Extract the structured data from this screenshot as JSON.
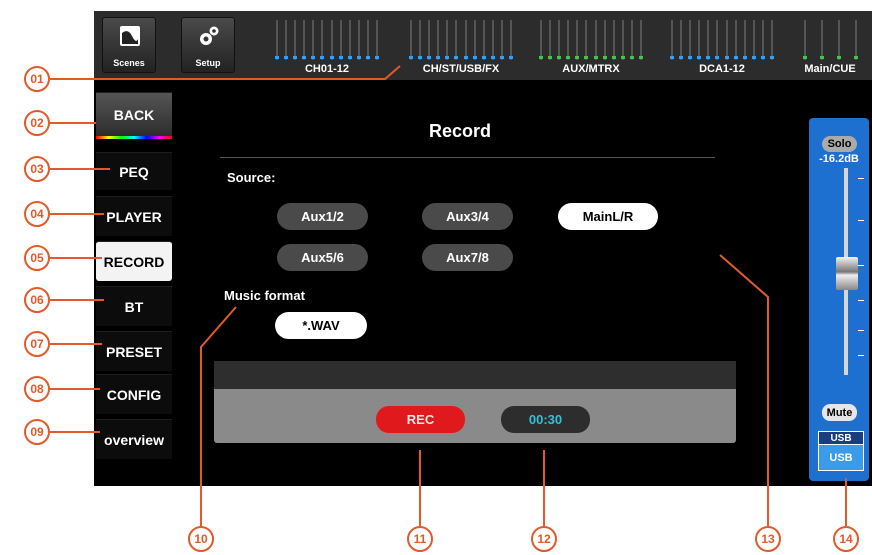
{
  "topbar": {
    "scenes_label": "Scenes",
    "setup_label": "Setup",
    "groups": [
      {
        "label": "CH01-12",
        "dot_color": "#2fa0ff"
      },
      {
        "label": "CH/ST/USB/FX",
        "dot_color": "#2fa0ff"
      },
      {
        "label": "AUX/MTRX",
        "dot_color": "#3ec84a"
      },
      {
        "label": "DCA1-12",
        "dot_color": "#2fa0ff"
      },
      {
        "label": "Main/CUE",
        "dot_color": "#3ec84a"
      }
    ]
  },
  "menu": {
    "back": "BACK",
    "items": [
      "PEQ",
      "PLAYER",
      "RECORD",
      "BT",
      "PRESET",
      "CONFIG",
      "overview"
    ],
    "active": "RECORD"
  },
  "record": {
    "title": "Record",
    "source_label": "Source:",
    "sources": [
      "Aux1/2",
      "Aux3/4",
      "MainL/R",
      "Aux5/6",
      "Aux7/8"
    ],
    "selected_source": "MainL/R",
    "format_label": "Music format",
    "format_value": "*.WAV",
    "rec_label": "REC",
    "rec_color": "#e0191c",
    "time": "00:30"
  },
  "fader": {
    "solo": "Solo",
    "level": "-16.2dB",
    "mute": "Mute",
    "usb_tag": "USB",
    "usb_button": "USB"
  },
  "callouts": [
    "01",
    "02",
    "03",
    "04",
    "05",
    "06",
    "07",
    "08",
    "09",
    "10",
    "11",
    "12",
    "13",
    "14"
  ],
  "callout_color": "#e2592a"
}
